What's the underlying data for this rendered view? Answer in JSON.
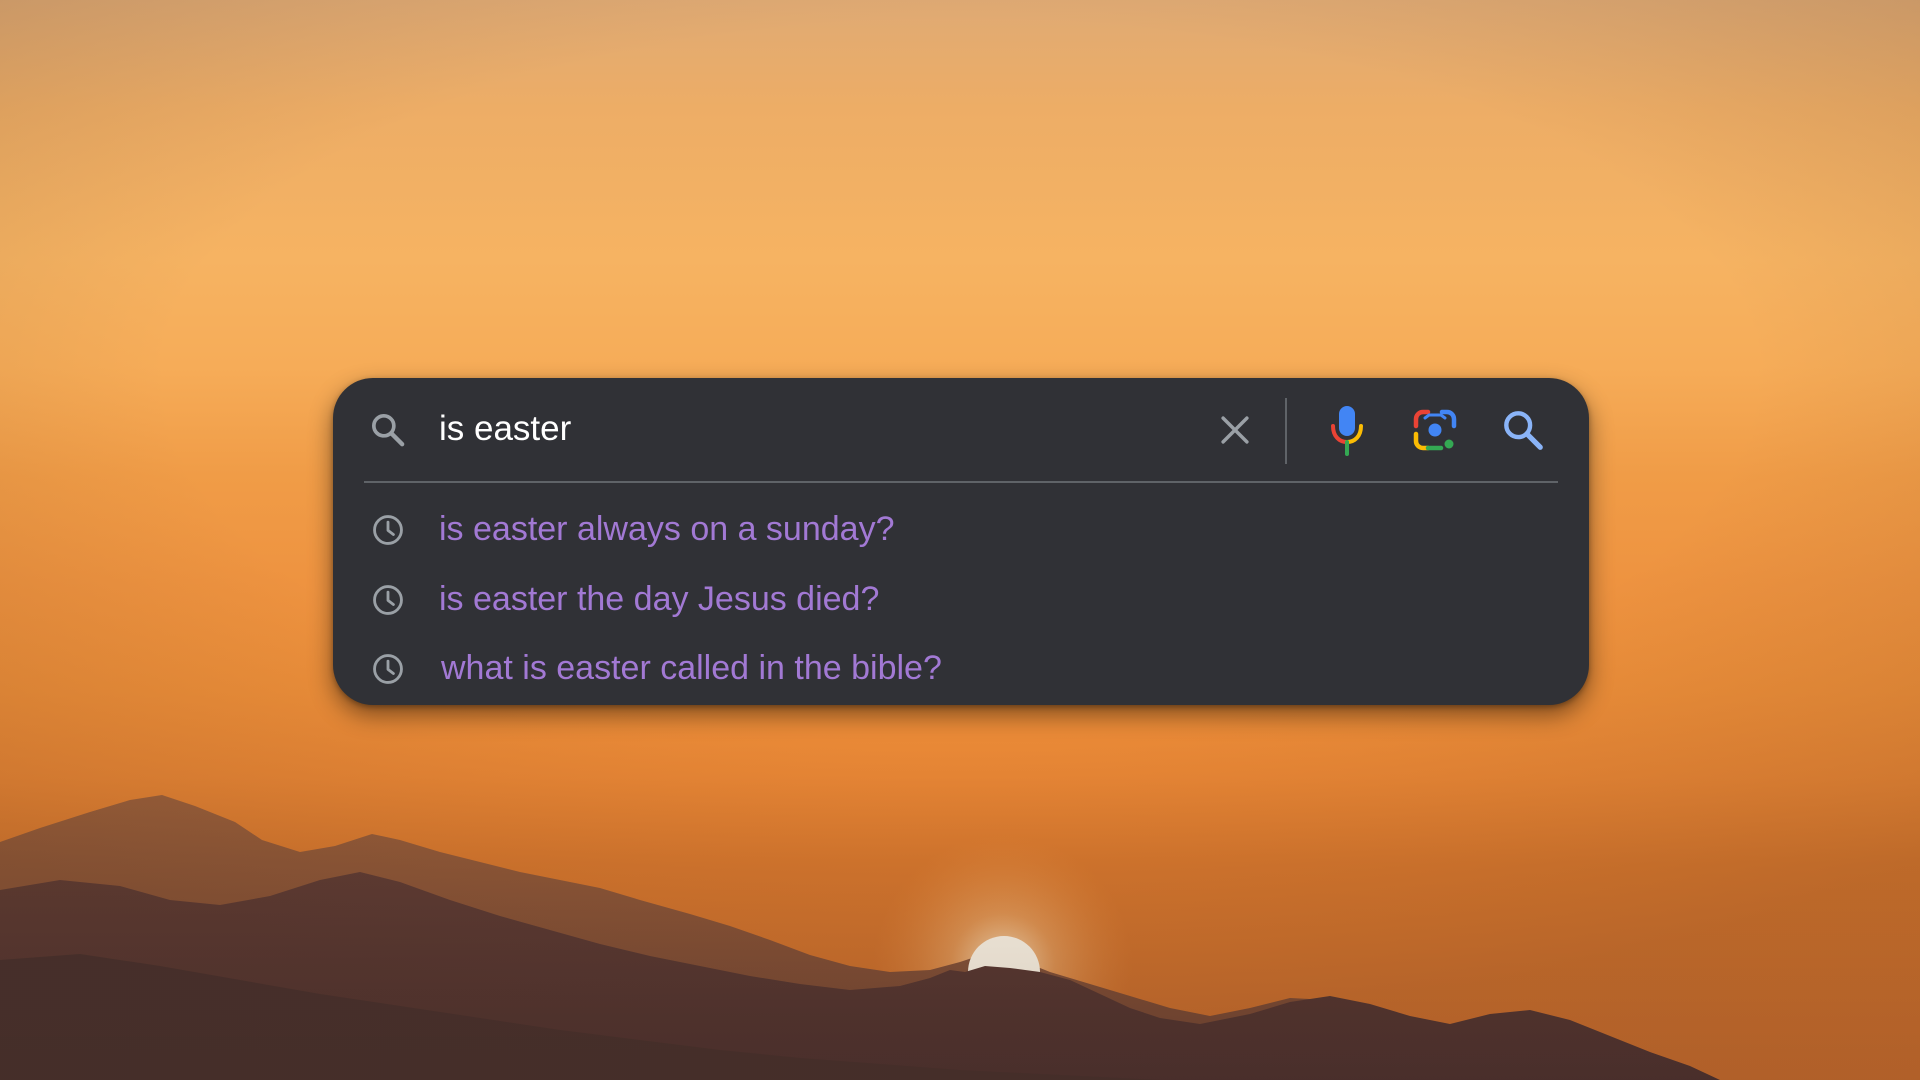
{
  "search": {
    "query": "is easter",
    "icons": {
      "leading": "search-icon",
      "clear": "close-icon",
      "voice": "microphone-icon",
      "lens": "camera-lens-icon",
      "submit": "search-icon"
    }
  },
  "suggestions": [
    {
      "icon": "history-clock-icon",
      "text": "is easter always on a sunday?"
    },
    {
      "icon": "history-clock-icon",
      "text": "is easter the day Jesus died?"
    },
    {
      "icon": "history-clock-icon",
      "text": "what is easter called in the bible?"
    }
  ],
  "colors": {
    "panel": "#303136",
    "query_text": "#ffffff",
    "suggestion_text": "#a279d4",
    "icon_gray": "#9aa0a6",
    "google_blue": "#4285f4",
    "google_red": "#ea4335",
    "google_yellow": "#fbbc04",
    "google_green": "#34a853",
    "submit_blue": "#8ab4f8"
  }
}
